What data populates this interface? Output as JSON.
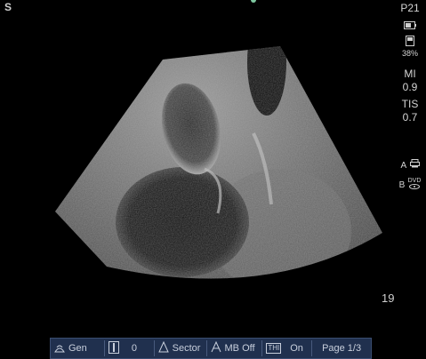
{
  "overlay": {
    "orientation": "S",
    "depth": "19"
  },
  "right_panel": {
    "preset": "P21",
    "battery": "38%",
    "mi_label": "MI",
    "mi_value": "0.9",
    "tis_label": "TIS",
    "tis_value": "0.7",
    "printer_a_label": "A",
    "printer_b_label": "B",
    "dvd_label": "DVD",
    "accent_color": "#7ec8a0"
  },
  "toolbar": {
    "mode": "Gen",
    "gain_value": "0",
    "image_format": "Sector",
    "mb_label": "MB Off",
    "thi_label": "THI",
    "thi_state": "On",
    "page": "Page 1/3",
    "background_color": "#20304e"
  },
  "icons": [
    "probe-icon",
    "gain-bar-icon",
    "sector-icon",
    "mb-icon",
    "thi-icon",
    "battery-icon",
    "printer-icon",
    "dvd-icon"
  ]
}
